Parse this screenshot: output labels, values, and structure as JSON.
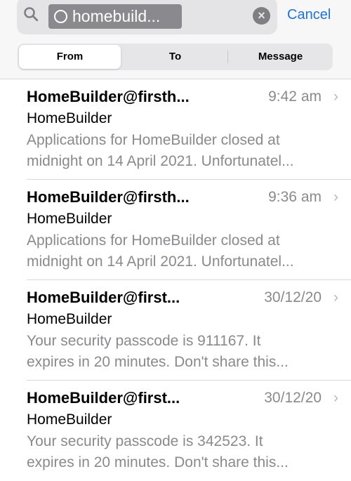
{
  "search": {
    "token": "homebuild...",
    "cancel_label": "Cancel"
  },
  "scope": {
    "tabs": [
      "From",
      "To",
      "Message"
    ],
    "selected": "From"
  },
  "messages": [
    {
      "sender": "HomeBuilder@firsth...",
      "time": "9:42 am",
      "subject": "HomeBuilder",
      "preview1": "Applications for HomeBuilder closed at",
      "preview2": "midnight on 14 April 2021. Unfortunatel..."
    },
    {
      "sender": "HomeBuilder@firsth...",
      "time": "9:36 am",
      "subject": "HomeBuilder",
      "preview1": "Applications for HomeBuilder closed at",
      "preview2": "midnight on 14 April 2021. Unfortunatel..."
    },
    {
      "sender": "HomeBuilder@first...",
      "time": "30/12/20",
      "subject": "HomeBuilder",
      "preview1": "Your security passcode is 911167. It",
      "preview2": "expires in 20 minutes. Don't share this..."
    },
    {
      "sender": "HomeBuilder@first...",
      "time": "30/12/20",
      "subject": "HomeBuilder",
      "preview1": "Your security passcode is 342523. It",
      "preview2": "expires in 20 minutes. Don't share this..."
    }
  ],
  "colors": {
    "accent": "#1a73e8",
    "secondary_text": "#8a8a8e"
  }
}
